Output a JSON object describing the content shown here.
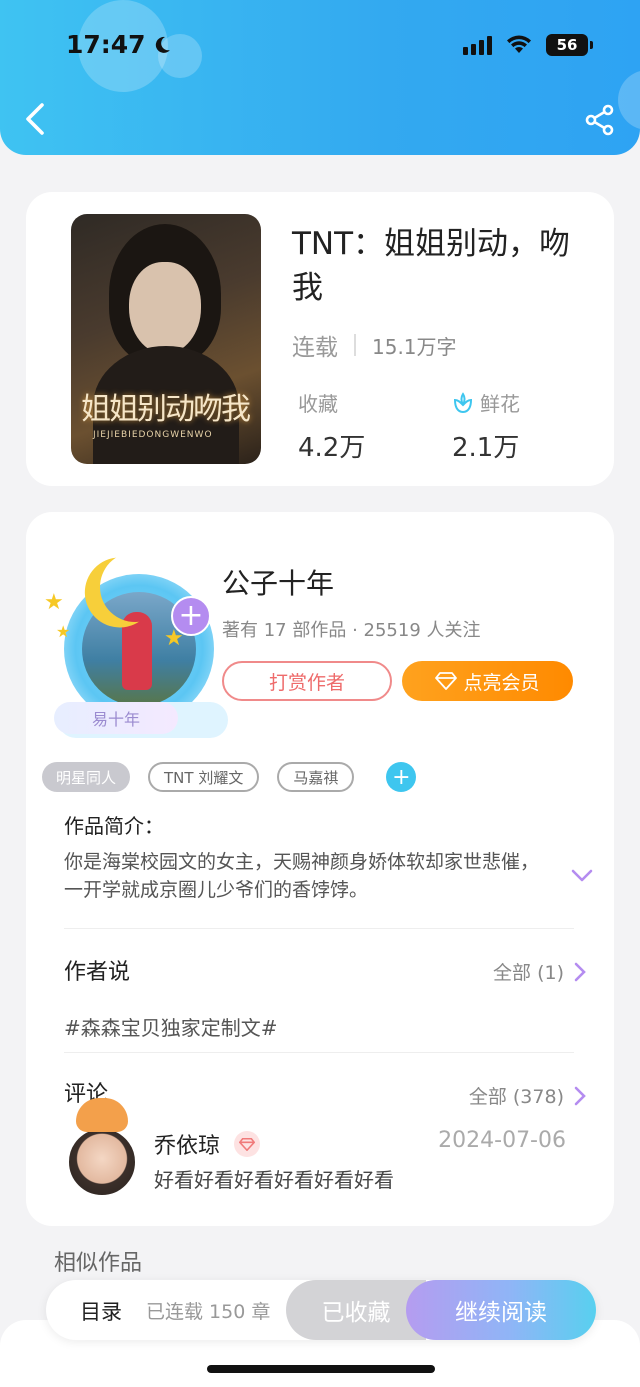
{
  "status_bar": {
    "time": "17:47",
    "battery": "56",
    "icons": [
      "moon-icon",
      "cellular-signal-icon",
      "wifi-icon",
      "battery-icon"
    ]
  },
  "nav": {
    "back_icon": "chevron-left-icon",
    "share_icon": "share-icon"
  },
  "book": {
    "title": "TNT：姐姐别动，吻我",
    "status": "连载",
    "word_count": "15.1万字",
    "favorites_label": "收藏",
    "favorites_value": "4.2万",
    "flowers_label": "鲜花",
    "flowers_value": "2.1万",
    "cover": {
      "title": "姐姐别动吻我",
      "subtitle": "JIEJIEBIEDONGWENWO"
    }
  },
  "author": {
    "name": "公子十年",
    "meta": "著有 17 部作品 · 25519 人关注",
    "name_tag": "易十年",
    "reward_label": "打赏作者",
    "vip_label": "点亮会员"
  },
  "tags": [
    "明星同人",
    "TNT 刘耀文",
    "马嘉祺"
  ],
  "intro": {
    "title": "作品简介：",
    "text": "你是海棠校园文的女主，天赐神颜身娇体软却家世悲催，一开学就成京圈儿少爷们的香饽饽。"
  },
  "author_says": {
    "title": "作者说",
    "all_label": "全部 (1)",
    "text": "#森森宝贝独家定制文#"
  },
  "comments": {
    "title": "评论",
    "all_label": "全部 (378)",
    "items": [
      {
        "user": "乔依琼",
        "date": "2024-07-06",
        "text": "好看好看好看好看好看好看"
      }
    ]
  },
  "similar_title": "相似作品",
  "bottom_bar": {
    "toc_label": "目录",
    "progress": "已连载 150 章",
    "favorited_label": "已收藏",
    "continue_label": "继续阅读"
  },
  "colors": {
    "header_blue": "#33a9f0",
    "vip_orange": "#ff8a00",
    "reward_red": "#ee6b6b",
    "tag_add_cyan": "#3ec6ef",
    "accent_purple": "#b48cf0"
  }
}
